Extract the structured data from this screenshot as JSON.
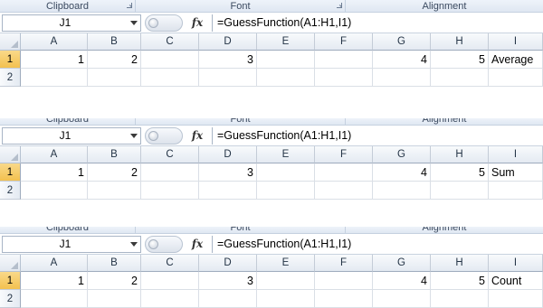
{
  "ribbon_groups": [
    "Clipboard",
    "Font",
    "Alignment"
  ],
  "columns": [
    "A",
    "B",
    "C",
    "D",
    "E",
    "F",
    "G",
    "H",
    "I"
  ],
  "panels": [
    {
      "name_box": "J1",
      "fx_label": "fx",
      "formula": "=GuessFunction(A1:H1,I1)",
      "rows": [
        {
          "header": "1",
          "cells": [
            "1",
            "2",
            "",
            "3",
            "",
            "",
            "4",
            "5",
            "Average"
          ]
        },
        {
          "header": "2",
          "cells": [
            "",
            "",
            "",
            "",
            "",
            "",
            "",
            "",
            ""
          ]
        }
      ]
    },
    {
      "name_box": "J1",
      "fx_label": "fx",
      "formula": "=GuessFunction(A1:H1,I1)",
      "rows": [
        {
          "header": "1",
          "cells": [
            "1",
            "2",
            "",
            "3",
            "",
            "",
            "4",
            "5",
            "Sum"
          ]
        },
        {
          "header": "2",
          "cells": [
            "",
            "",
            "",
            "",
            "",
            "",
            "",
            "",
            ""
          ]
        }
      ]
    },
    {
      "name_box": "J1",
      "fx_label": "fx",
      "formula": "=GuessFunction(A1:H1,I1)",
      "rows": [
        {
          "header": "1",
          "cells": [
            "1",
            "2",
            "",
            "3",
            "",
            "",
            "4",
            "5",
            "Count"
          ]
        },
        {
          "header": "2",
          "cells": [
            "",
            "",
            "",
            "",
            "",
            "",
            "",
            "",
            ""
          ]
        }
      ]
    }
  ]
}
